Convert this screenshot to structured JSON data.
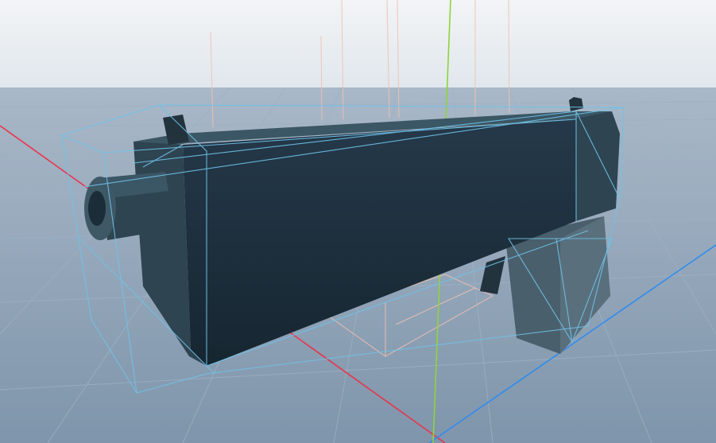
{
  "viewport": {
    "colors": {
      "sky_top": "#f2f4f6",
      "sky_horizon": "#dfe6ec",
      "ground_far": "#a9b8c8",
      "ground_near": "#7f95ab",
      "grid_line": "#9db0c4",
      "axis_x": "#e8344b",
      "axis_y": "#8fd43a",
      "axis_z": "#2f8cf0",
      "model_body": "#1b2d38",
      "model_side": "#2e4451",
      "model_highlight": "#3b5664",
      "grip": "#4a5f6c",
      "collider_wire": "#6fc2e8",
      "bounds_wire": "#f1c0b0"
    }
  }
}
